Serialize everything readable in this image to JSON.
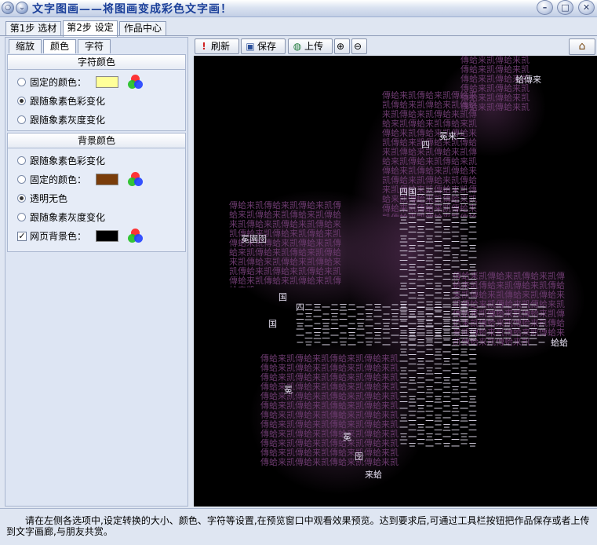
{
  "window": {
    "title": "文字图画——将图画变成彩色文字画！",
    "buttons": [
      "minimize",
      "maximize",
      "close"
    ]
  },
  "steps": [
    {
      "label": "第1步 选材",
      "active": false
    },
    {
      "label": "第2步 设定",
      "active": true
    },
    {
      "label": "作品中心",
      "active": false
    }
  ],
  "settings_tabs": [
    {
      "label": "缩放",
      "active": false
    },
    {
      "label": "颜色",
      "active": true
    },
    {
      "label": "字符",
      "active": false
    }
  ],
  "char_color": {
    "heading": "字符颜色",
    "options": [
      {
        "label": "固定的颜色：",
        "checked": false
      },
      {
        "label": "跟随象素色彩变化",
        "checked": true
      },
      {
        "label": "跟随象素灰度变化",
        "checked": false
      }
    ],
    "fixed_swatch": "#ffff99"
  },
  "bg_color": {
    "heading": "背景颜色",
    "options": [
      {
        "label": "跟随象素色彩变化",
        "checked": false
      },
      {
        "label": "固定的颜色：",
        "checked": false
      },
      {
        "label": "透明无色",
        "checked": true
      },
      {
        "label": "跟随象素灰度变化",
        "checked": false
      }
    ],
    "fixed_swatch": "#7a3d0a",
    "page_bg_label": "网页背景色：",
    "page_bg_checked": true,
    "page_bg_swatch": "#000000"
  },
  "toolbar": {
    "refresh": "刷新",
    "save": "保存",
    "upload": "上传",
    "zoom_in_icon": "zoom-in-icon",
    "zoom_out_icon": "zoom-out-icon",
    "home_icon": "home-icon"
  },
  "preview": {
    "background": "#000000",
    "glyph_color_light": "#e4def0",
    "glyph_color_purple": "#6b3a6e",
    "glyphs": [
      "傳",
      "蛤",
      "来",
      "凯",
      "四",
      "国",
      "困",
      "囝",
      "冕",
      "園",
      "圆",
      "三",
      "二",
      "一",
      "〓"
    ]
  },
  "footer": {
    "hint": "请在左侧各选项中,设定转换的大小、颜色、字符等设置,在预览窗口中观看效果预览。达到要求后,可通过工具栏按钮把作品保存或者上传到文字画廊,与朋友共赏。"
  }
}
